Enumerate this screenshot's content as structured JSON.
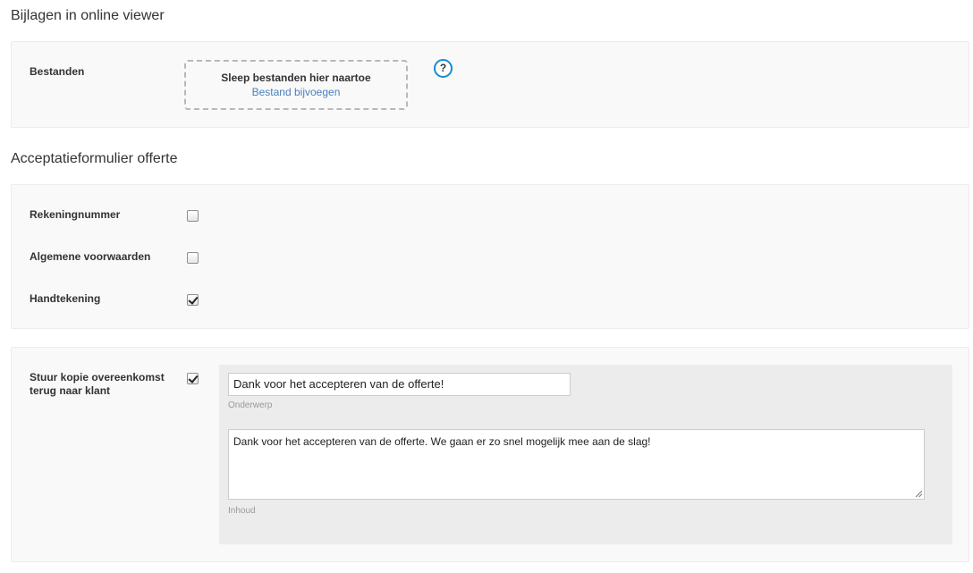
{
  "attachments": {
    "title": "Bijlagen in online viewer",
    "files_label": "Bestanden",
    "dropzone_title": "Sleep bestanden hier naartoe",
    "dropzone_link": "Bestand bijvoegen",
    "help_icon": "?"
  },
  "acceptance": {
    "title": "Acceptatieformulier offerte",
    "options": [
      {
        "label": "Rekeningnummer",
        "checked": false
      },
      {
        "label": "Algemene voorwaarden",
        "checked": false
      },
      {
        "label": "Handtekening",
        "checked": true
      }
    ]
  },
  "send_copy": {
    "label_line1": "Stuur kopie overeenkomst",
    "label_line2": "terug naar klant",
    "checked": true,
    "subject_value": "Dank voor het accepteren van de offerte!",
    "subject_caption": "Onderwerp",
    "body_value": "Dank voor het accepteren van de offerte. We gaan er zo snel mogelijk mee aan de slag!",
    "body_caption": "Inhoud"
  }
}
